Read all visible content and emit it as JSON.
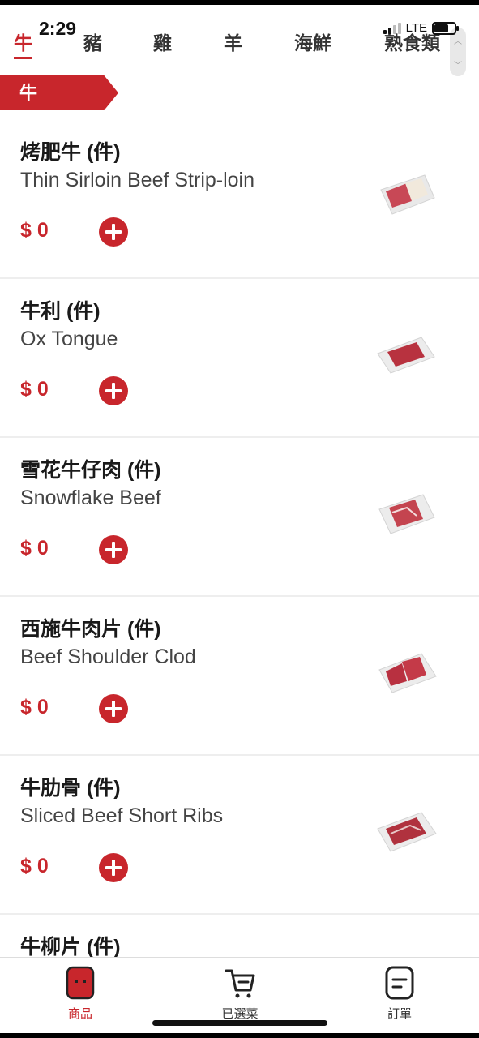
{
  "status_bar": {
    "time": "2:29",
    "network": "LTE"
  },
  "categories": [
    {
      "label": "牛",
      "active": true
    },
    {
      "label": "豬",
      "active": false
    },
    {
      "label": "雞",
      "active": false
    },
    {
      "label": "羊",
      "active": false
    },
    {
      "label": "海鮮",
      "active": false
    },
    {
      "label": "熟食類",
      "active": false
    }
  ],
  "section_label": "牛",
  "products": [
    {
      "name": "烤肥牛 (件)",
      "english": "Thin Sirloin Beef Strip-loin",
      "price": "$ 0"
    },
    {
      "name": "牛利 (件)",
      "english": "Ox Tongue",
      "price": "$ 0"
    },
    {
      "name": "雪花牛仔肉 (件)",
      "english": "Snowflake Beef",
      "price": "$ 0"
    },
    {
      "name": "西施牛肉片 (件)",
      "english": "Beef Shoulder Clod",
      "price": "$ 0"
    },
    {
      "name": "牛肋骨 (件)",
      "english": "Sliced Beef Short Ribs",
      "price": "$ 0"
    },
    {
      "name": "牛柳片 (件)"
    }
  ],
  "bottom_nav": [
    {
      "label": "商品",
      "icon": "product-icon",
      "active": true
    },
    {
      "label": "已選菜",
      "icon": "cart-icon",
      "active": false
    },
    {
      "label": "訂單",
      "icon": "order-icon",
      "active": false
    }
  ],
  "colors": {
    "accent": "#c8262c"
  }
}
